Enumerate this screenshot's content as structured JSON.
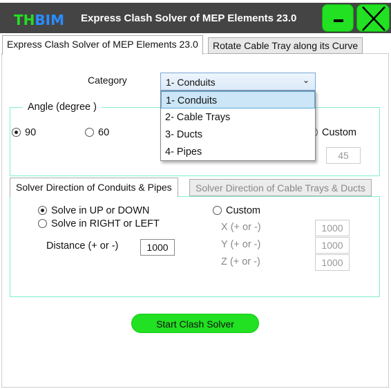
{
  "titlebar": {
    "logo_part1": "TH",
    "logo_part2": "BIM",
    "title": "Express Clash Solver of MEP Elements 23.0",
    "minimize_label": "–",
    "close_label": "✕"
  },
  "tabs": [
    {
      "label": "Express Clash Solver of MEP Elements 23.0"
    },
    {
      "label": "Rotate Cable Tray along its Curve"
    }
  ],
  "category": {
    "label": "Category",
    "selected": "1- Conduits",
    "options": [
      "1- Conduits",
      "2- Cable Trays",
      "3- Ducts",
      "4- Pipes"
    ]
  },
  "angle": {
    "legend": "Angle (degree )",
    "options": [
      {
        "label": "90",
        "checked": true
      },
      {
        "label": "60",
        "checked": false
      },
      {
        "label": "Custom",
        "checked": false
      }
    ],
    "custom_value": "45"
  },
  "solver_tabs": [
    {
      "label": "Solver Direction of Conduits & Pipes"
    },
    {
      "label": "Solver Direction of Cable Trays & Ducts"
    }
  ],
  "solver": {
    "up_down": "Solve in UP or DOWN",
    "right_left": "Solve in RIGHT or LEFT",
    "distance_label": "Distance (+ or -)",
    "distance_value": "1000",
    "custom": "Custom",
    "x_label": "X (+ or -)",
    "x_value": "1000",
    "y_label": "Y (+ or -)",
    "y_value": "1000",
    "z_label": "Z (+ or -)",
    "z_value": "1000"
  },
  "start_button": "Start Clash Solver",
  "colors": {
    "accent": "#22e022",
    "title_bg": "#444444",
    "group_border": "#7fefcf"
  }
}
